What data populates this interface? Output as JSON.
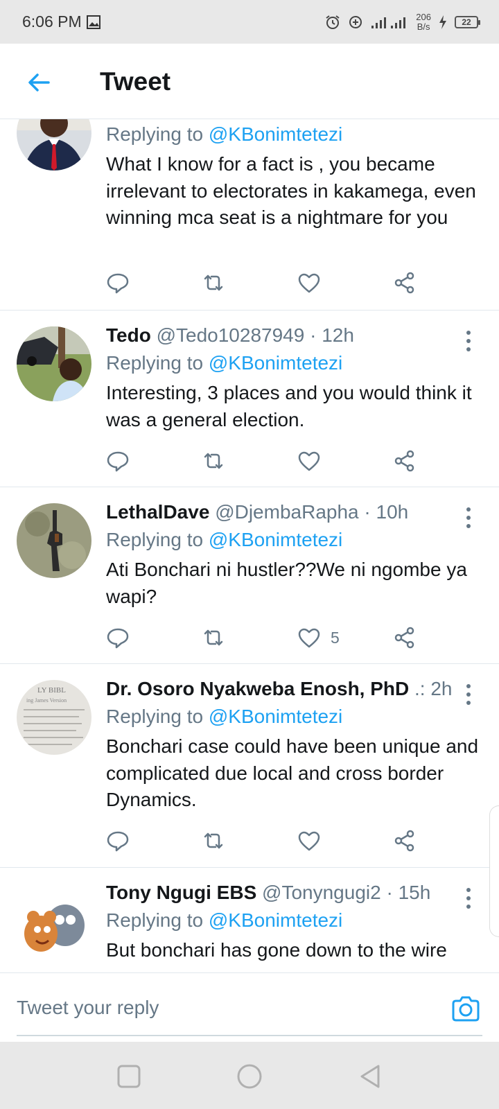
{
  "status_bar": {
    "time": "6:06 PM",
    "net_speed_value": "206",
    "net_speed_unit": "B/s",
    "battery": "22"
  },
  "header": {
    "title": "Tweet",
    "back_icon": "arrow-left-icon"
  },
  "tweets": [
    {
      "name": "",
      "handle": "",
      "time": "",
      "replying_prefix": "Replying to ",
      "replying_to": "@KBonimtetezi",
      "text": "What I know for a fact is , you became irrelevant to electorates in kakamega, even winning mca seat is a nightmare for you",
      "likes": ""
    },
    {
      "name": "Tedo",
      "handle": "@Tedo10287949",
      "time": " · 12h",
      "replying_prefix": "Replying to ",
      "replying_to": "@KBonimtetezi",
      "text": "Interesting, 3 places and you would think it was a general election.",
      "likes": ""
    },
    {
      "name": "LethalDave",
      "handle": "@DjembaRapha",
      "time": " · 10h",
      "replying_prefix": "Replying to ",
      "replying_to": "@KBonimtetezi",
      "text": "Ati Bonchari ni hustler??We ni ngombe ya wapi?",
      "likes": "5"
    },
    {
      "name": "Dr. Osoro Nyakweba Enosh, PhD",
      "handle": " .:",
      "time": " 2h",
      "replying_prefix": "Replying to ",
      "replying_to": "@KBonimtetezi",
      "text": "Bonchari case could have been unique and complicated due local and cross border Dynamics.",
      "likes": ""
    },
    {
      "name": "Tony Ngugi EBS",
      "handle": "@Tonyngugi2",
      "time": " · 15h",
      "replying_prefix": "Replying to ",
      "replying_to": "@KBonimtetezi",
      "text": "But bonchari has gone down to the wire",
      "likes": ""
    }
  ],
  "avatar_texts": {
    "bible_line1": "LY BIBL",
    "bible_line2": "ing James Version"
  },
  "reply_bar": {
    "placeholder": "Tweet your reply",
    "camera_icon": "camera-icon"
  },
  "colors": {
    "accent": "#1da1f2",
    "muted": "#657786",
    "text": "#14171a"
  }
}
